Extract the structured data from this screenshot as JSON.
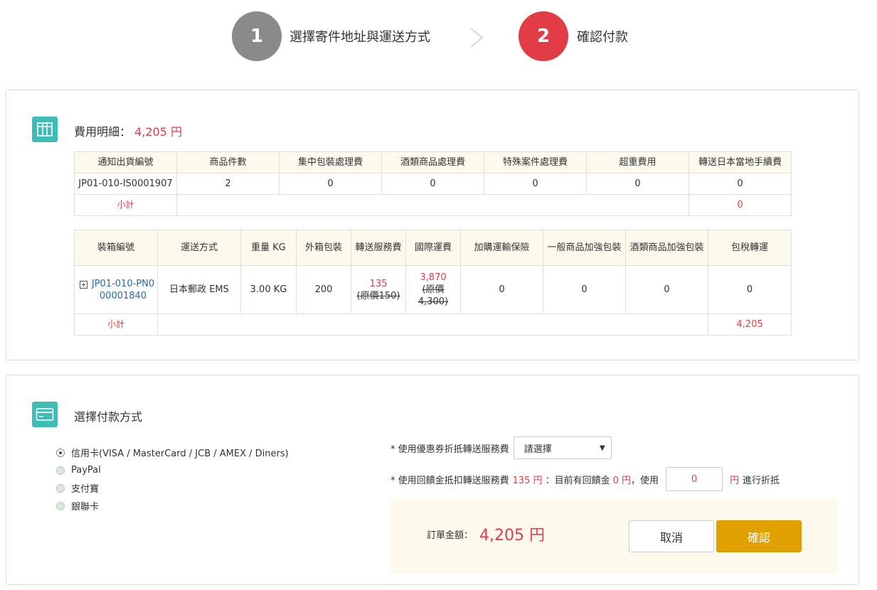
{
  "steps": {
    "step1_number": "1",
    "step1_label": "選擇寄件地址與運送方式",
    "step2_number": "2",
    "step2_label": "確認付款"
  },
  "fee": {
    "title": "費用明細：",
    "total": "4,205 円",
    "table1": {
      "headers": [
        "通知出貨編號",
        "商品件數",
        "集中包裝處理費",
        "酒類商品處理費",
        "特殊案件處理費",
        "超重費用",
        "轉送日本當地手續費"
      ],
      "row": [
        "JP01-010-IS0001907",
        "2",
        "0",
        "0",
        "0",
        "0",
        "0"
      ],
      "subtotal_label": "小計",
      "subtotal_value": "0"
    },
    "table2": {
      "headers": [
        "裝箱編號",
        "運送方式",
        "重量 KG",
        "外箱包裝",
        "轉送服務費",
        "國際運費",
        "加購運輸保險",
        "一般商品加強包裝",
        "酒類商品加強包裝",
        "包稅轉運"
      ],
      "expand_icon": "plus-square-icon",
      "box_id": "JP01-010-PN000001840",
      "method": "日本郵政 EMS",
      "weight": "3.00 KG",
      "packaging": "200",
      "service_fee": "135",
      "service_fee_orig": "(原價150)",
      "intl_fee": "3,870",
      "intl_fee_orig": "(原價4,300)",
      "insurance": "0",
      "general_reinforce": "0",
      "alcohol_reinforce": "0",
      "tax_transfer": "0",
      "subtotal_label": "小計",
      "subtotal_value": "4,205"
    }
  },
  "payment": {
    "title": "選擇付款方式",
    "options": [
      "信用卡(VISA / MasterCard / JCB / AMEX / Diners)",
      "PayPal",
      "支付寶",
      "銀聯卡"
    ],
    "selected_index": 0,
    "coupon_label": "* 使用優惠券折抵轉送服務費",
    "coupon_select": "請選擇",
    "rebate_prefix": "* 使用回饋金抵扣轉送服務費",
    "rebate_fee": "135 円",
    "rebate_mid": "：目前有回饋金",
    "rebate_balance": "0 円",
    "rebate_use": "，使用",
    "rebate_input": "0",
    "rebate_unit": "円",
    "rebate_suffix": "進行折抵",
    "order_label": "訂單金額：",
    "order_amount": "4,205 円",
    "cancel_label": "取消",
    "confirm_label": "確認"
  },
  "colors": {
    "accent_red": "#e23c46",
    "teal": "#3ebcb6",
    "gold": "#e0a000"
  }
}
